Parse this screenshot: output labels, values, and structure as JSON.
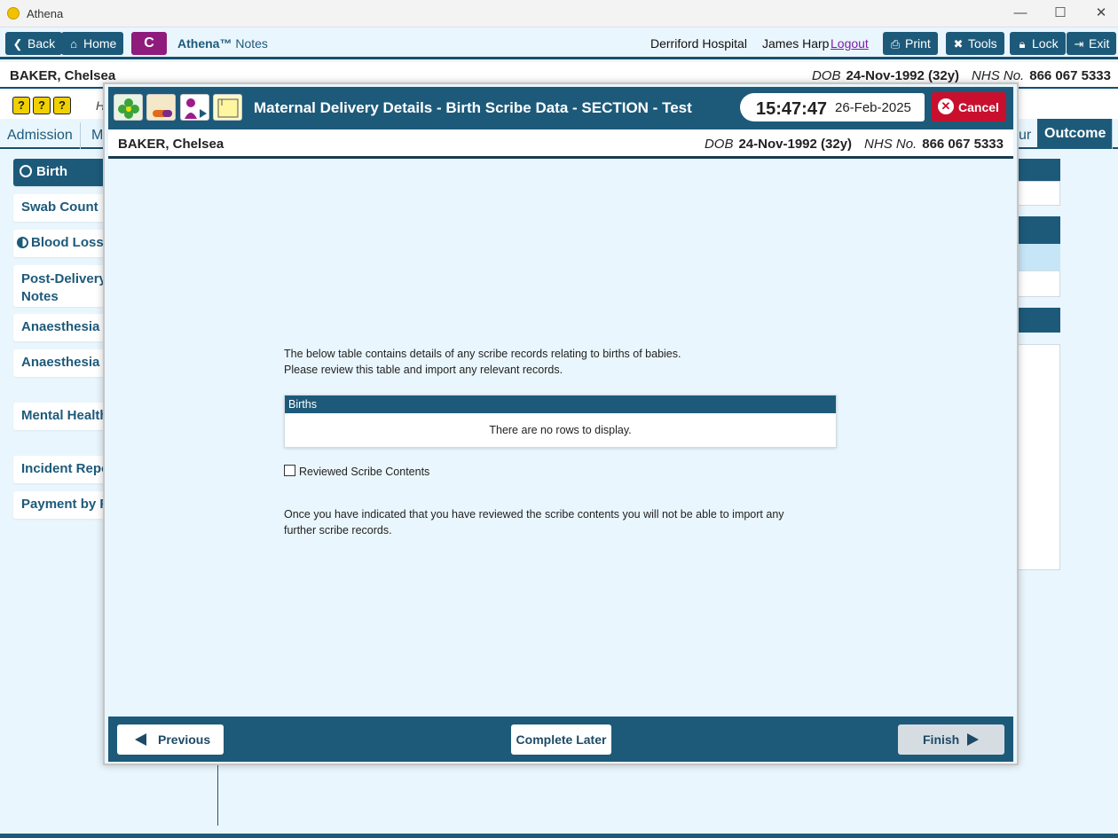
{
  "window": {
    "title": "Athena",
    "min": "—",
    "max": "☐",
    "close": "✕"
  },
  "toolbar": {
    "back": "Back",
    "home": "Home",
    "c_label": "C",
    "app_brand": "Athena™",
    "app_suffix": " Notes",
    "hospital": "Derriford Hospital",
    "user": "James Harp",
    "logout": "Logout",
    "print": "Print",
    "tools": "Tools",
    "lock": "Lock",
    "exit": "Exit"
  },
  "patient": {
    "name": "BAKER, Chelsea",
    "dob_label": "DOB",
    "dob": "24-Nov-1992 (32y)",
    "nhs_label": "NHS No.",
    "nhs": "866 067 5333"
  },
  "helprow": {
    "placeholder": "H"
  },
  "tabs": {
    "admission": "Admission",
    "m": "M",
    "ur": "ur",
    "outcome": "Outcome"
  },
  "nav": [
    {
      "label": "Birth"
    },
    {
      "label": "Swab Count"
    },
    {
      "label": "Blood Loss"
    },
    {
      "label": "Post-Delivery"
    },
    {
      "label": "Notes"
    },
    {
      "label": "Anaesthesia In"
    },
    {
      "label": "Anaesthesia Fo"
    },
    {
      "label": "Mental Health"
    },
    {
      "label": "Incident Repo"
    },
    {
      "label": "Payment by R"
    }
  ],
  "dialog": {
    "title": "Maternal Delivery Details - Birth Scribe Data - SECTION - Test",
    "time": "15:47:47",
    "date": "26-Feb-2025",
    "cancel": "Cancel",
    "intro_line1": "The below table contains details of any scribe records relating to births of babies.",
    "intro_line2": "Please review this table and import any relevant records.",
    "births_header": "Births",
    "births_empty": "There are no rows to display.",
    "checkbox_label": "Reviewed Scribe Contents",
    "note_line1": "Once you have indicated that you have reviewed the scribe contents you will not be able to import any",
    "note_line2": "further scribe records.",
    "previous": "Previous",
    "complete_later": "Complete Later",
    "finish": "Finish"
  }
}
